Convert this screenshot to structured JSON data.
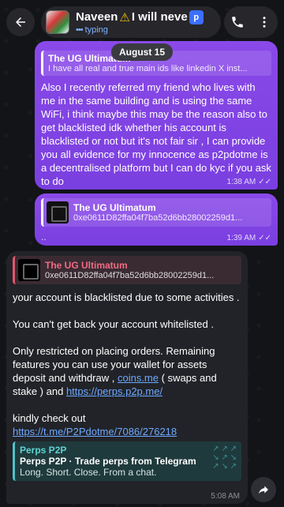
{
  "header": {
    "name": "Naveen",
    "name_suffix": "I will neve",
    "warn_icon": "warning-icon",
    "status": "typing",
    "brand_icon": "p"
  },
  "date_chip": "August 15",
  "outgoing": [
    {
      "reply_name": "The UG Ultimatum",
      "reply_text": "I have all real and true main ids like linkedin X inst...",
      "text": "Also I recently referred my friend who lives with me in the same building and is using the same WiFi, i think maybe this may be the reason also to get blacklisted idk whether his account is blacklisted or not but it's not fair sir , I can provide you all evidence for my innocence as p2pdotme is a decentralised platform but I can do kyc if you ask to do",
      "time": "1:38 AM"
    },
    {
      "fwd_name": "The UG Ultimatum",
      "fwd_hash": "0xe0611D82ffa04f7ba52d6bb28002259d1...",
      "dots": "..",
      "time": "1:39 AM"
    }
  ],
  "incoming": {
    "fwd_name": "The UG Ultimatum",
    "fwd_hash": "0xe0611D82ffa04f7ba52d6bb28002259d1...",
    "p1": "your account is blacklisted due to  some activities .",
    "p2": "You can't get back your account whitelisted .",
    "p3_a": "Only restricted on placing orders. Remaining features you can use your wallet for assets deposit and withdraw , ",
    "p3_link1": "coins.me",
    "p3_b": " ( swaps and stake )  and ",
    "p3_link2": "https://perps.p2p.me/",
    "p4_a": " kindly check out ",
    "p4_link": "https://t.me/P2Pdotme/7086/276218",
    "preview_site": "Perps P2P",
    "preview_title": "Perps P2P · Trade perps from Telegram",
    "preview_desc": "Long. Short. Close. From a chat.",
    "time": "5:08 AM"
  },
  "colors": {
    "outgoing_bubble": "#7a3fe0",
    "incoming_bubble": "#212328",
    "link": "#6ea8ff",
    "accent_red": "#f26b83",
    "preview_teal": "#5fd4d4"
  }
}
